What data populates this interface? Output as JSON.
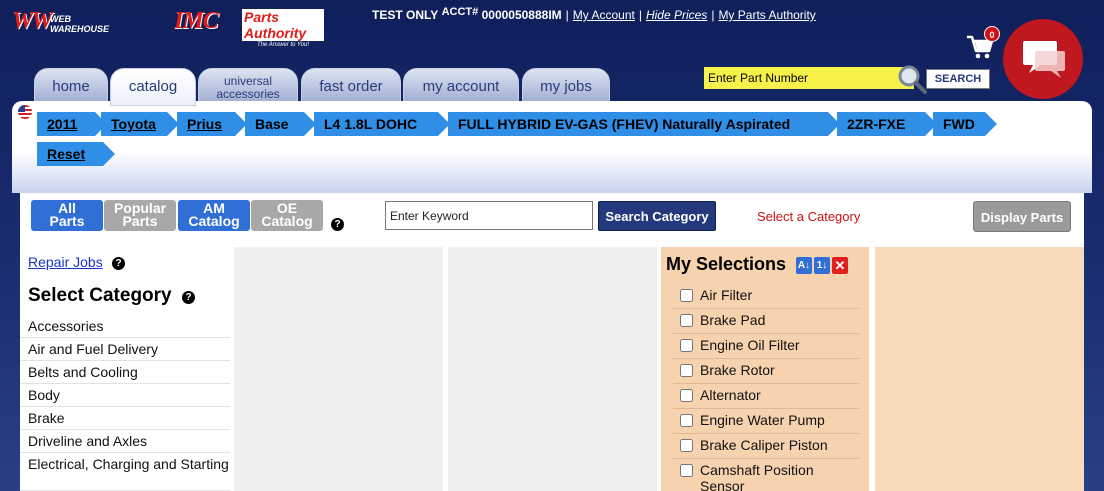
{
  "header": {
    "logos": {
      "ww_mark": "WW",
      "ww_text": "WEB WAREHOUSE",
      "imc": "IMC",
      "parts_authority": "Parts Authority",
      "pa_tagline": "The Answer to You!"
    },
    "test_only": "TEST ONLY",
    "acct_label": "ACCT#",
    "acct_number": "0000050888IM",
    "links": {
      "my_account": "My Account",
      "hide_prices": "Hide Prices",
      "my_parts_authority": "My Parts Authority"
    },
    "cart_count": "0",
    "part_search_placeholder": "Enter Part Number",
    "search_button": "SEARCH"
  },
  "tabs": [
    {
      "label": "home"
    },
    {
      "label": "catalog"
    },
    {
      "label": "universal accessories"
    },
    {
      "label": "fast order"
    },
    {
      "label": "my account"
    },
    {
      "label": "my jobs"
    }
  ],
  "vehicle": {
    "crumbs": [
      "2011",
      "Toyota",
      "Prius",
      "Base",
      "L4 1.8L DOHC",
      "FULL HYBRID EV-GAS (FHEV) Naturally Aspirated",
      "2ZR-FXE",
      "FWD"
    ],
    "reset": "Reset"
  },
  "catalog_buttons": [
    {
      "line1": "All",
      "line2": "Parts"
    },
    {
      "line1": "Popular",
      "line2": "Parts"
    },
    {
      "line1": "AM",
      "line2": "Catalog"
    },
    {
      "line1": "OE",
      "line2": "Catalog"
    }
  ],
  "keyword": {
    "placeholder": "Enter Keyword"
  },
  "search_category": "Search Category",
  "select_category_hint": "Select a Category",
  "display_parts": "Display Parts",
  "sidebar": {
    "repair_jobs": "Repair Jobs",
    "heading": "Select Category",
    "categories": [
      "Accessories",
      "Air and Fuel Delivery",
      "Belts and Cooling",
      "Body",
      "Brake",
      "Driveline and Axles",
      "Electrical, Charging and Starting"
    ]
  },
  "my_selections": {
    "heading": "My Selections",
    "icons": [
      "sort-alpha-icon",
      "sort-numeric-icon",
      "clear-icon"
    ],
    "items": [
      "Air Filter",
      "Brake Pad",
      "Engine Oil Filter",
      "Brake Rotor",
      "Alternator",
      "Engine Water Pump",
      "Brake Caliper Piston",
      "Camshaft Position Sensor"
    ]
  },
  "colors": {
    "header_bg": "#1c2f74",
    "tab_text": "#283b7c",
    "crumb_blue": "#2f8fe6",
    "button_blue": "#2f6fd6",
    "search_category_bg": "#23397c",
    "selections_bg": "#f6d3ae",
    "hint_red": "#d01010",
    "chat_red": "#c0181f"
  }
}
